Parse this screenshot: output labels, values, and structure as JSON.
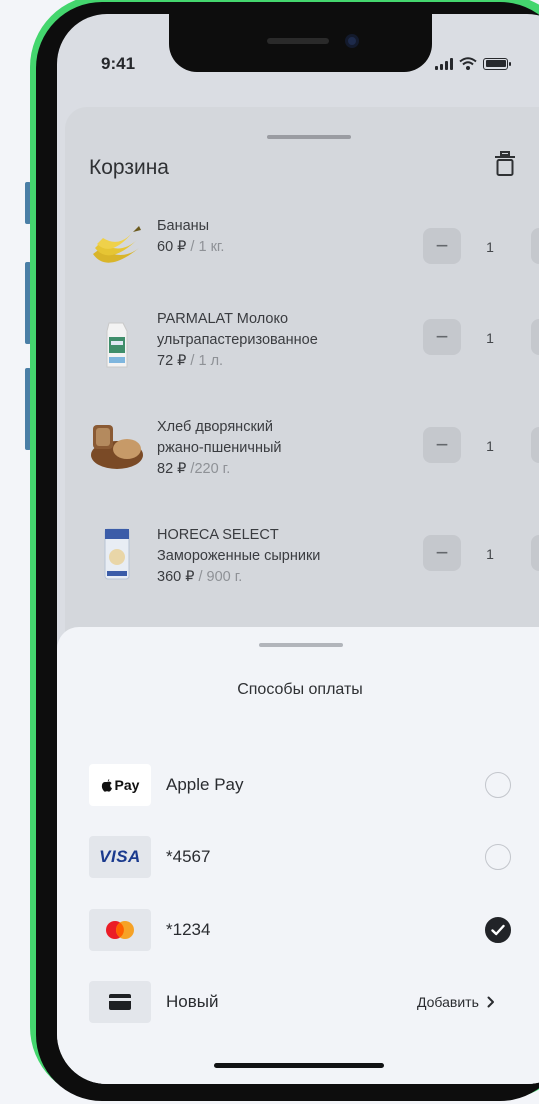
{
  "status": {
    "time": "9:41"
  },
  "cart": {
    "title": "Корзина",
    "items": [
      {
        "name_lines": [
          "Бананы"
        ],
        "price": "60 ₽",
        "unit": " / 1 кг.",
        "qty": "1",
        "thumb": "banana-thumbnail"
      },
      {
        "name_lines": [
          "PARMALAT Молоко",
          "ультрапастеризованное"
        ],
        "price": "72 ₽",
        "unit": " / 1 л.",
        "qty": "1",
        "thumb": "milk-thumbnail"
      },
      {
        "name_lines": [
          "Хлеб дворянский",
          "ржано-пшеничный"
        ],
        "price": "82 ₽",
        "unit": " /220 г.",
        "qty": "1",
        "thumb": "bread-thumbnail"
      },
      {
        "name_lines": [
          "HORECA SELECT",
          "Замороженные сырники"
        ],
        "price": "360 ₽",
        "unit": " / 900 г.",
        "qty": "1",
        "thumb": "syrniki-thumbnail"
      }
    ],
    "minus": "−",
    "plus": "+"
  },
  "payment": {
    "title": "Способы оплаты",
    "methods": [
      {
        "label": "Apple Pay",
        "icon_text": "Pay",
        "icon": "apple-pay-icon",
        "selected": false
      },
      {
        "label": "*4567",
        "icon_text": "VISA",
        "icon": "visa-icon",
        "selected": false
      },
      {
        "label": "*1234",
        "icon_text": "",
        "icon": "mastercard-icon",
        "selected": true
      },
      {
        "label": "Новый",
        "icon_text": "",
        "icon": "card-icon",
        "action": "Добавить"
      }
    ]
  },
  "colors": {
    "frame": "#44d66e",
    "sheet": "#f2f4f8",
    "dim": "#d4d7dc",
    "visa": "#1a3a8e"
  }
}
